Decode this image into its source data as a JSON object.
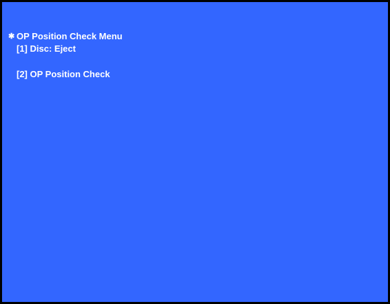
{
  "screen": {
    "background_color": "#3366ff",
    "border_color": "#000000",
    "text_color": "#ffffff"
  },
  "menu": {
    "cursor_marker": "✱",
    "title": "OP Position Check Menu",
    "items": [
      {
        "label": "[1] Disc: Eject"
      },
      {
        "label": "[2] OP Position Check"
      }
    ]
  }
}
